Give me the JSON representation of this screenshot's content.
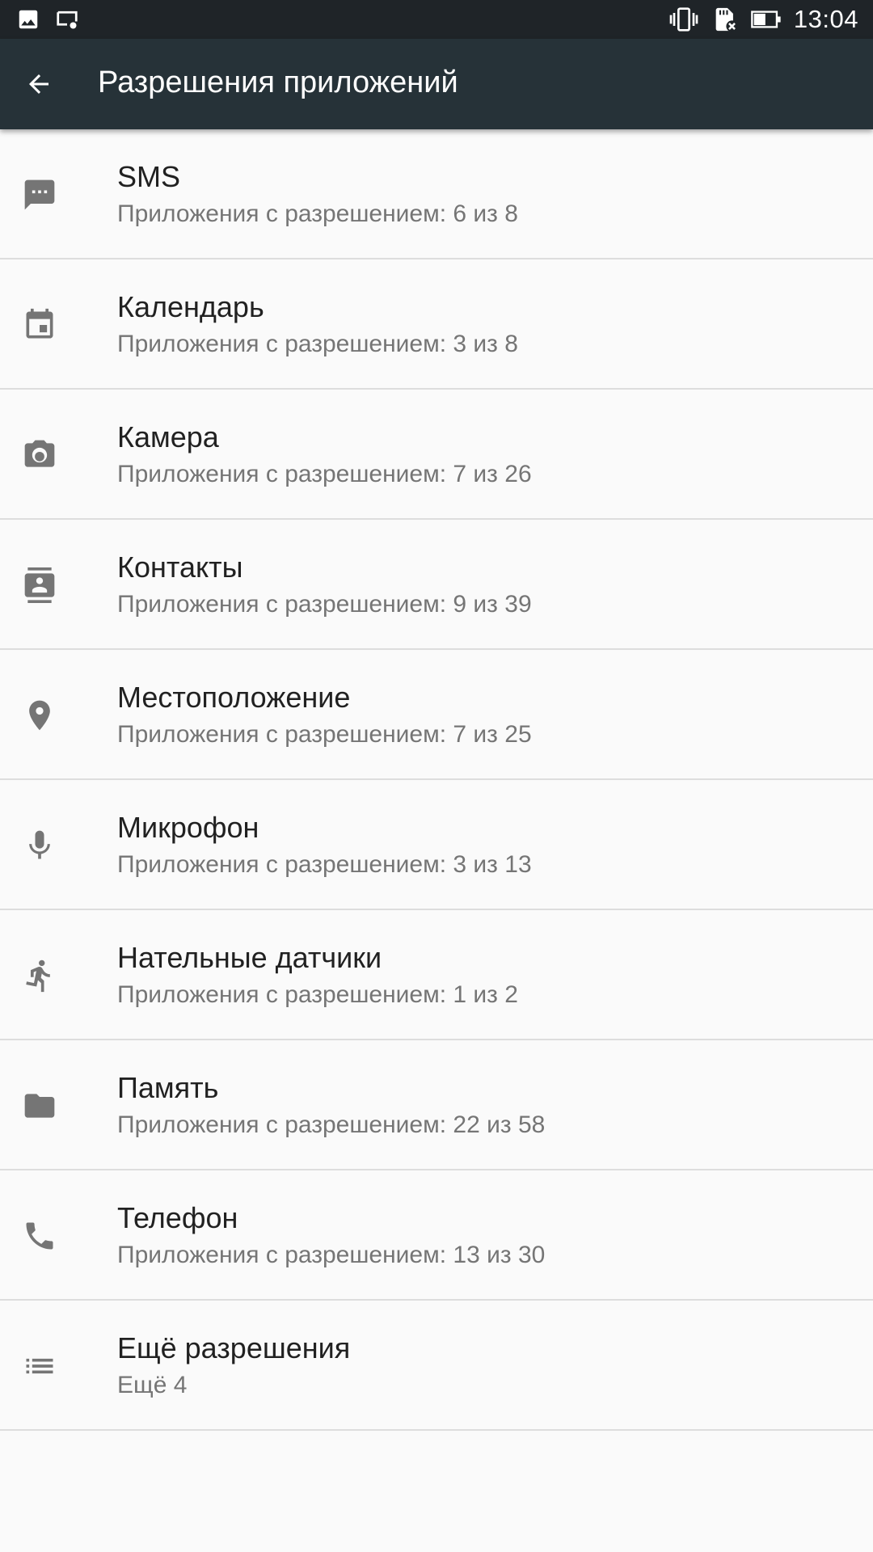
{
  "status_bar": {
    "time": "13:04",
    "left_icons": [
      "image-icon",
      "screen-settings-icon"
    ],
    "right_icons": [
      "vibrate-icon",
      "sd-card-error-icon",
      "battery-icon"
    ]
  },
  "app_bar": {
    "title": "Разрешения приложений",
    "back_icon": "arrow-back-icon"
  },
  "colors": {
    "status_bar_bg": "#1f2428",
    "app_bar_bg": "#263238",
    "background": "#fafafa",
    "icon": "#757575",
    "title_text": "#212121",
    "subtitle_text": "#757575",
    "divider": "#dddddd"
  },
  "permissions": [
    {
      "icon": "sms-icon",
      "title": "SMS",
      "subtitle": "Приложения с разрешением: 6 из 8"
    },
    {
      "icon": "calendar-icon",
      "title": "Календарь",
      "subtitle": "Приложения с разрешением: 3 из 8"
    },
    {
      "icon": "camera-icon",
      "title": "Камера",
      "subtitle": "Приложения с разрешением: 7 из 26"
    },
    {
      "icon": "contacts-icon",
      "title": "Контакты",
      "subtitle": "Приложения с разрешением: 9 из 39"
    },
    {
      "icon": "location-icon",
      "title": "Местоположение",
      "subtitle": "Приложения с разрешением: 7 из 25"
    },
    {
      "icon": "microphone-icon",
      "title": "Микрофон",
      "subtitle": "Приложения с разрешением: 3 из 13"
    },
    {
      "icon": "body-sensors-icon",
      "title": "Нательные датчики",
      "subtitle": "Приложения с разрешением: 1 из 2"
    },
    {
      "icon": "folder-icon",
      "title": "Память",
      "subtitle": "Приложения с разрешением: 22 из 58"
    },
    {
      "icon": "phone-icon",
      "title": "Телефон",
      "subtitle": "Приложения с разрешением: 13 из 30"
    },
    {
      "icon": "list-icon",
      "title": "Ещё разрешения",
      "subtitle": "Ещё 4"
    }
  ]
}
